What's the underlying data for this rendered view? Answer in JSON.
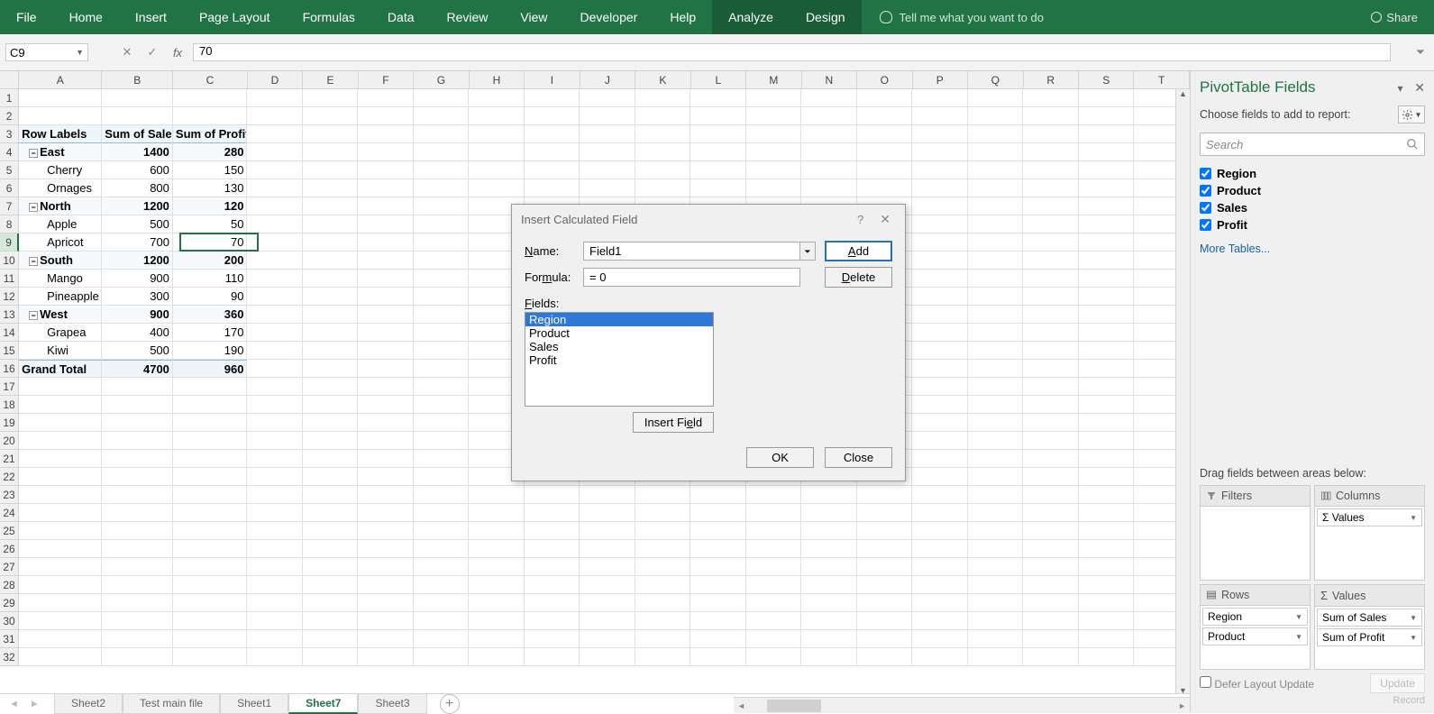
{
  "ribbon": {
    "tabs": [
      "File",
      "Home",
      "Insert",
      "Page Layout",
      "Formulas",
      "Data",
      "Review",
      "View",
      "Developer",
      "Help",
      "Analyze",
      "Design"
    ],
    "active": "Analyze",
    "tellme": "Tell me what you want to do",
    "share": "Share"
  },
  "nameBox": "C9",
  "formulaValue": "70",
  "columns": [
    "A",
    "B",
    "C",
    "D",
    "E",
    "F",
    "G",
    "H",
    "I",
    "J",
    "K",
    "L",
    "M",
    "N",
    "O",
    "P",
    "Q",
    "R",
    "S",
    "T"
  ],
  "rowCount": 32,
  "pivotHeaders": {
    "rowLabels": "Row Labels",
    "sumSales": "Sum of Sales",
    "sumProfit": "Sum of Profit"
  },
  "pivot": [
    {
      "type": "region",
      "label": "East",
      "sales": 1400,
      "profit": 280
    },
    {
      "type": "item",
      "label": "Cherry",
      "sales": 600,
      "profit": 150
    },
    {
      "type": "item",
      "label": "Ornages",
      "sales": 800,
      "profit": 130
    },
    {
      "type": "region",
      "label": "North",
      "sales": 1200,
      "profit": 120
    },
    {
      "type": "item",
      "label": "Apple",
      "sales": 500,
      "profit": 50
    },
    {
      "type": "item",
      "label": "Apricot",
      "sales": 700,
      "profit": 70
    },
    {
      "type": "region",
      "label": "South",
      "sales": 1200,
      "profit": 200
    },
    {
      "type": "item",
      "label": "Mango",
      "sales": 900,
      "profit": 110
    },
    {
      "type": "item",
      "label": "Pineapple",
      "sales": 300,
      "profit": 90
    },
    {
      "type": "region",
      "label": "West",
      "sales": 900,
      "profit": 360
    },
    {
      "type": "item",
      "label": "Grapea",
      "sales": 400,
      "profit": 170
    },
    {
      "type": "item",
      "label": "Kiwi",
      "sales": 500,
      "profit": 190
    }
  ],
  "grandTotal": {
    "label": "Grand Total",
    "sales": 4700,
    "profit": 960
  },
  "sheetTabs": {
    "tabs": [
      "Sheet2",
      "Test main file",
      "Sheet1",
      "Sheet7",
      "Sheet3"
    ],
    "active": "Sheet7"
  },
  "dialog": {
    "title": "Insert Calculated Field",
    "nameLabel": "Name:",
    "formulaLabel": "Formula:",
    "nameValue": "Field1",
    "formulaValue": "= 0",
    "addBtn": "Add",
    "deleteBtn": "Delete",
    "fieldsLabel": "Fields:",
    "fields": [
      "Region",
      "Product",
      "Sales",
      "Profit"
    ],
    "insertFieldBtn": "Insert Field",
    "ok": "OK",
    "close": "Close"
  },
  "pivotPane": {
    "title": "PivotTable Fields",
    "subtitle": "Choose fields to add to report:",
    "searchPlaceholder": "Search",
    "fields": [
      "Region",
      "Product",
      "Sales",
      "Profit"
    ],
    "moreTables": "More Tables...",
    "dragLabel": "Drag fields between areas below:",
    "filters": "Filters",
    "columns": "Columns",
    "rows": "Rows",
    "values": "Values",
    "columnsItems": [
      "Σ  Values"
    ],
    "rowsItems": [
      "Region",
      "Product"
    ],
    "valuesItems": [
      "Sum of Sales",
      "Sum of Profit"
    ],
    "defer": "Defer Layout Update",
    "update": "Update",
    "record": "Record"
  }
}
